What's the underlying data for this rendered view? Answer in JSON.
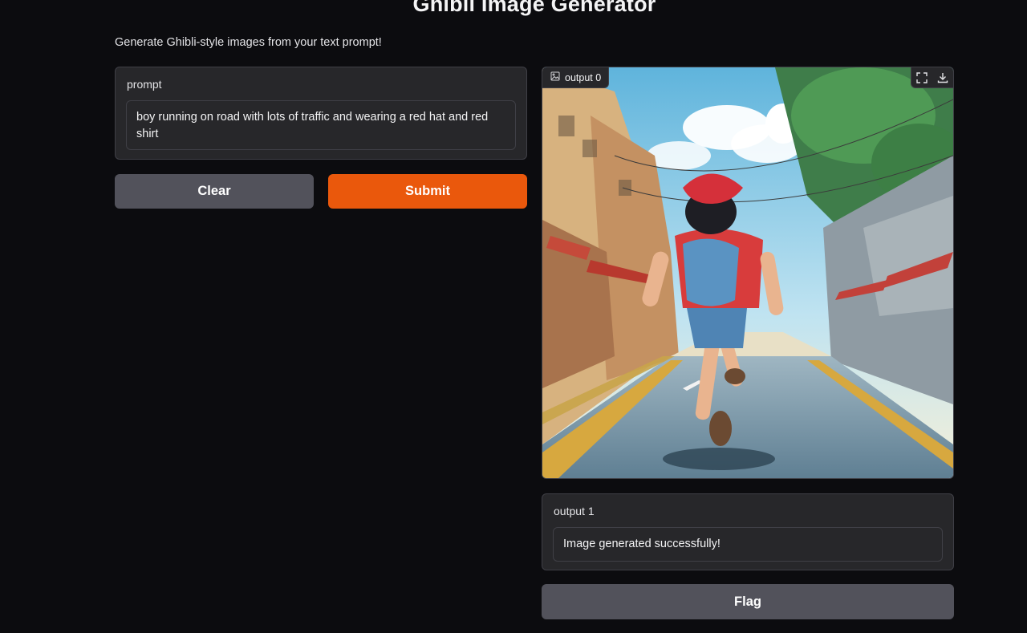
{
  "app": {
    "title": "Ghibli Image Generator",
    "description": "Generate Ghibli-style images from your text prompt!"
  },
  "input": {
    "label": "prompt",
    "value": "boy running on road with lots of traffic and wearing a red hat and red shirt"
  },
  "buttons": {
    "clear": "Clear",
    "submit": "Submit",
    "flag": "Flag"
  },
  "output_image": {
    "label": "output 0",
    "icons": [
      "image-icon",
      "fullscreen-icon",
      "download-icon"
    ]
  },
  "output_text": {
    "label": "output 1",
    "value": "Image generated successfully!"
  },
  "colors": {
    "background": "#0c0c0f",
    "panel": "#27272a",
    "border": "#3f3f46",
    "primary": "#ea580c",
    "secondary": "#52525b"
  }
}
